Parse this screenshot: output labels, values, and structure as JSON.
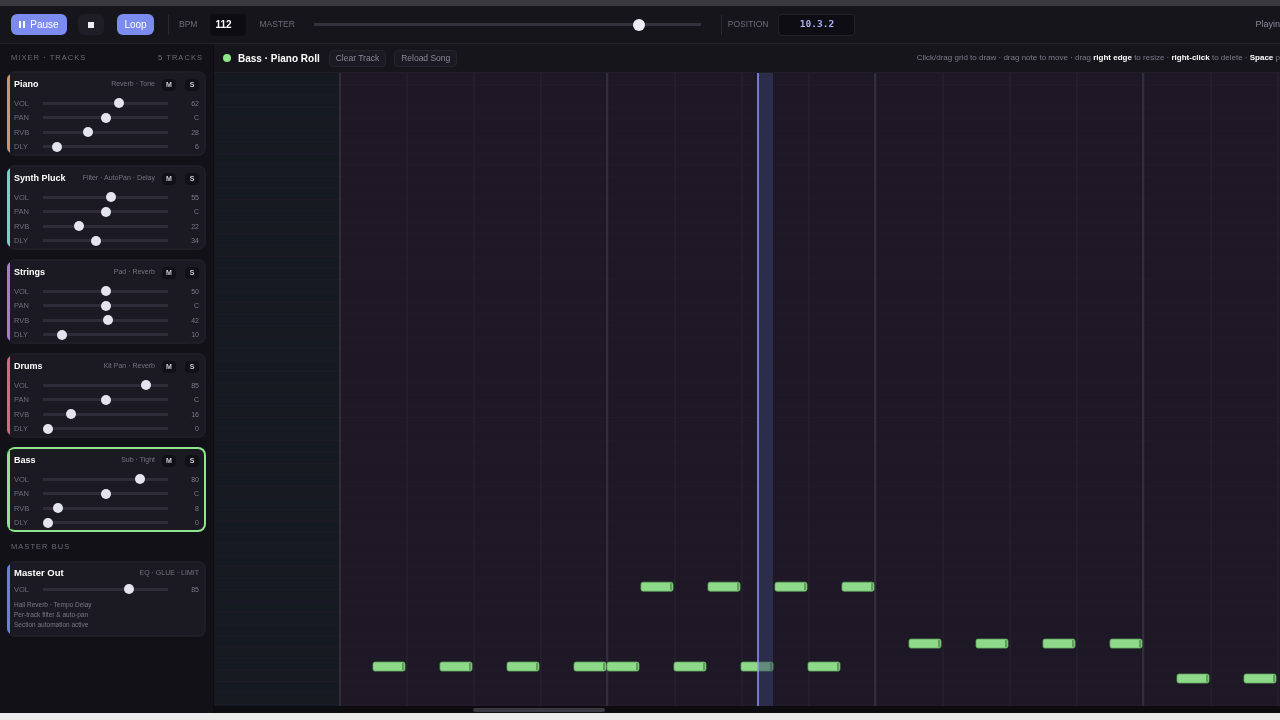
{
  "toolbar": {
    "transport": [
      {
        "kind": "pause",
        "label": "Pause",
        "on": true
      },
      {
        "kind": "stop",
        "on": false
      },
      {
        "kind": "loop",
        "label": "Loop",
        "on": true
      }
    ],
    "bpm": {
      "label": "BPM",
      "value": "112"
    },
    "master": {
      "label": "MASTER",
      "level": 0.85
    },
    "position": {
      "label": "POSITION",
      "value": "10.3.2"
    },
    "status": "Playin"
  },
  "mixer": {
    "title": "MIXER · TRACKS",
    "count": "5 TRACKS",
    "tracks": [
      {
        "name": "Piano",
        "effects": "Reverb · Tone",
        "color": "#d4926a",
        "selected": false,
        "buttons": [
          "M",
          "S"
        ],
        "controls": [
          {
            "label": "VOL",
            "level": 0.62,
            "reading": "62"
          },
          {
            "label": "PAN",
            "level": 0.5,
            "reading": "C"
          },
          {
            "label": "RVB",
            "level": 0.35,
            "reading": "28"
          },
          {
            "label": "DLY",
            "level": 0.08,
            "reading": "6"
          }
        ]
      },
      {
        "name": "Synth Pluck",
        "effects": "Filter · AutoPan · Delay",
        "color": "#6fd6c6",
        "selected": false,
        "buttons": [
          "M",
          "S"
        ],
        "controls": [
          {
            "label": "VOL",
            "level": 0.55,
            "reading": "55"
          },
          {
            "label": "PAN",
            "level": 0.5,
            "reading": "C"
          },
          {
            "label": "RVB",
            "level": 0.27,
            "reading": "22"
          },
          {
            "label": "DLY",
            "level": 0.42,
            "reading": "34"
          }
        ]
      },
      {
        "name": "Strings",
        "effects": "Pad · Reverb",
        "color": "#a77ad8",
        "selected": false,
        "buttons": [
          "M",
          "S"
        ],
        "controls": [
          {
            "label": "VOL",
            "level": 0.5,
            "reading": "50"
          },
          {
            "label": "PAN",
            "level": 0.5,
            "reading": "C"
          },
          {
            "label": "RVB",
            "level": 0.52,
            "reading": "42"
          },
          {
            "label": "DLY",
            "level": 0.12,
            "reading": "10"
          }
        ]
      },
      {
        "name": "Drums",
        "effects": "Kit Pan · Reverb",
        "color": "#e0647f",
        "selected": false,
        "buttons": [
          "M",
          "S"
        ],
        "controls": [
          {
            "label": "VOL",
            "level": 0.85,
            "reading": "85"
          },
          {
            "label": "PAN",
            "level": 0.5,
            "reading": "C"
          },
          {
            "label": "RVB",
            "level": 0.2,
            "reading": "16"
          },
          {
            "label": "DLY",
            "level": 0,
            "reading": "0"
          }
        ]
      },
      {
        "name": "Bass",
        "effects": "Sub · Tight",
        "color": "#8ee58a",
        "selected": true,
        "buttons": [
          "M",
          "S"
        ],
        "controls": [
          {
            "label": "VOL",
            "level": 0.8,
            "reading": "80"
          },
          {
            "label": "PAN",
            "level": 0.5,
            "reading": "C"
          },
          {
            "label": "RVB",
            "level": 0.09,
            "reading": "8"
          },
          {
            "label": "DLY",
            "level": 0,
            "reading": "0"
          }
        ]
      }
    ]
  },
  "master_bus": {
    "title": "MASTER BUS",
    "output": {
      "name": "Master Out",
      "effects": "EQ · GLUE · LIMIT",
      "color": "#6b7fe3",
      "controls": [
        {
          "label": "VOL",
          "level": 0.7,
          "reading": "85"
        }
      ],
      "notes": [
        "Hall Reverb · Tempo Delay",
        "Per-track filter & auto-pan",
        "Section automation active"
      ]
    }
  },
  "editor": {
    "title": "Bass · Piano Roll",
    "buttons": [
      "Clear Track",
      "Reload Song"
    ],
    "hint": "Click/drag grid to draw · drag note to move · drag **right edge** to resize · **right-click** to delete · **Space** p"
  }
}
